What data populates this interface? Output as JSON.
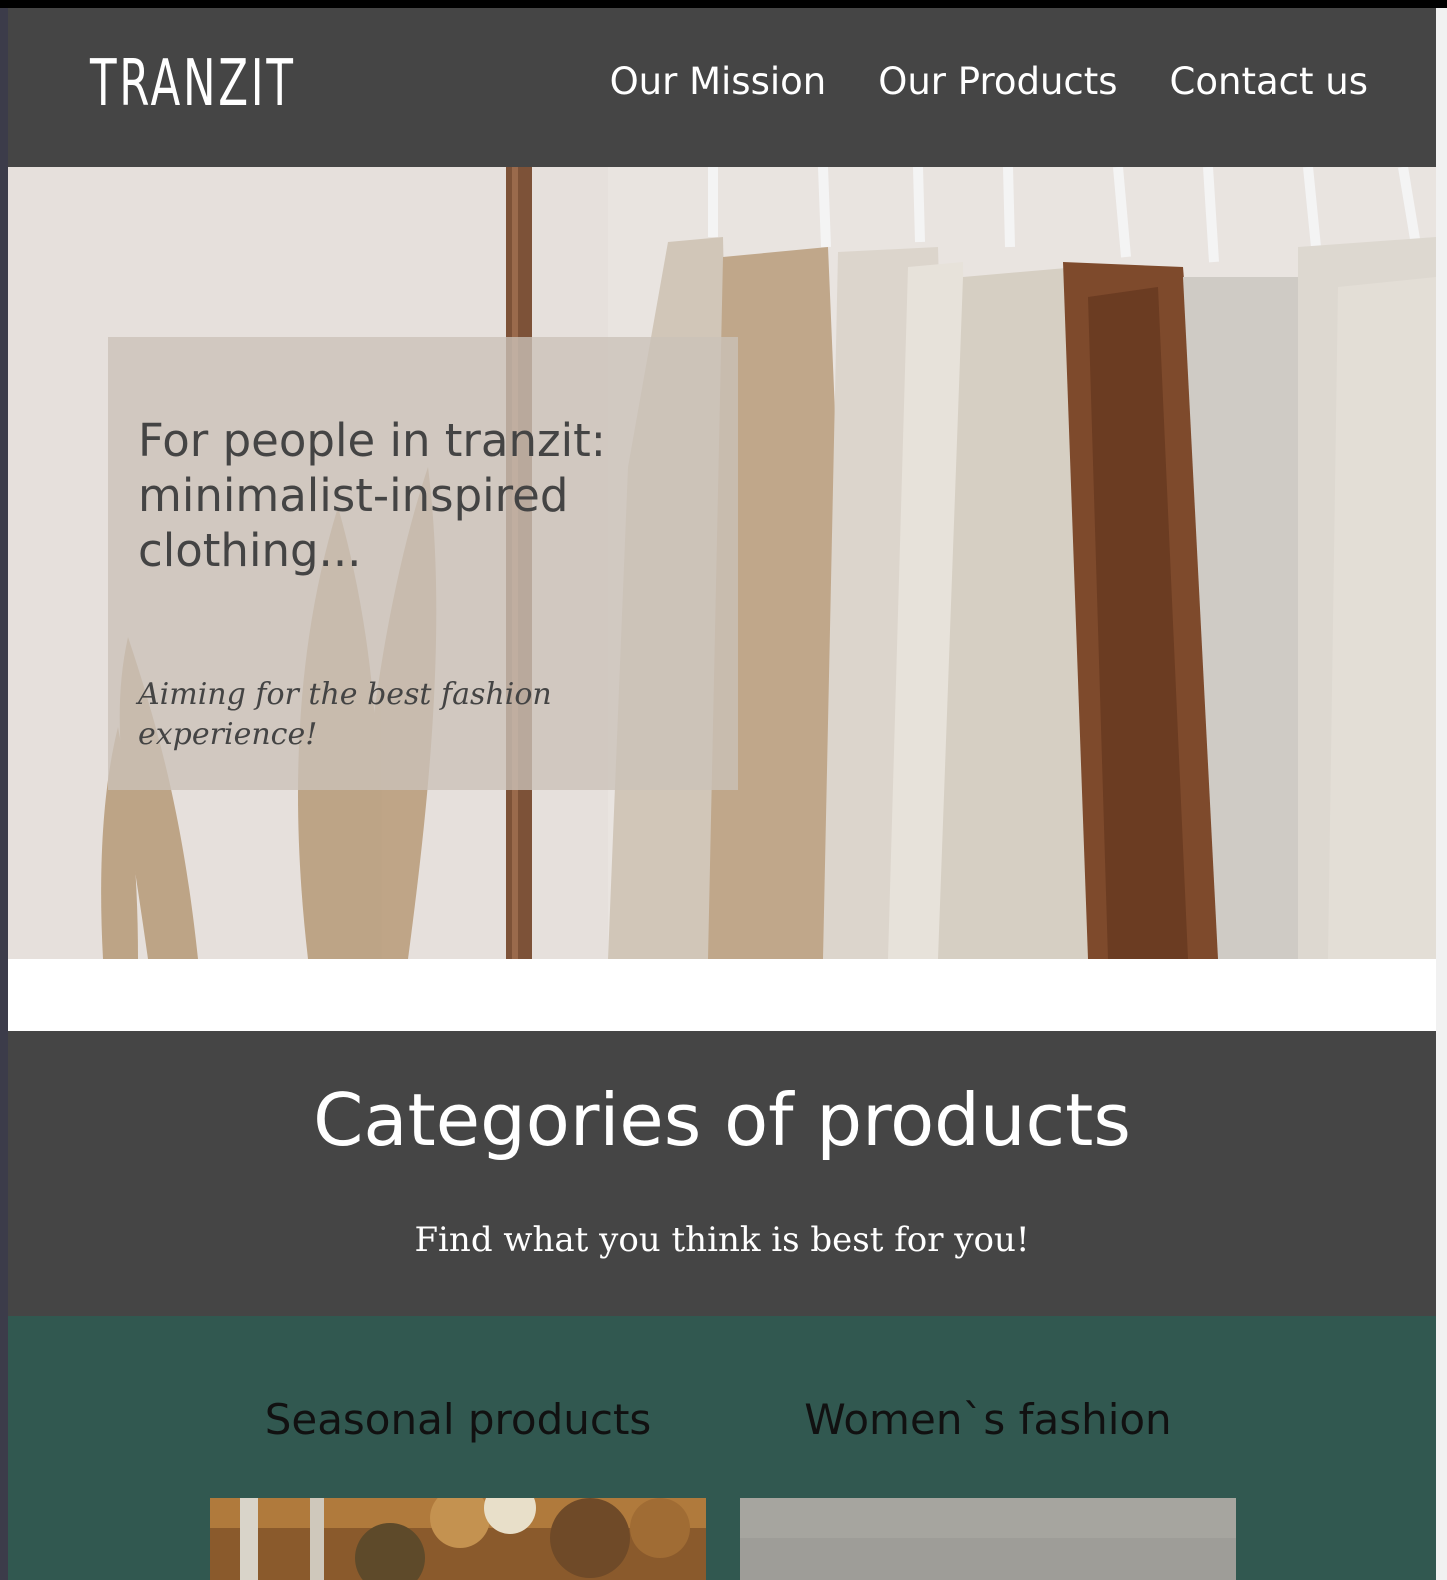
{
  "brand": {
    "logo": "TRANZIT"
  },
  "nav": {
    "items": [
      "Our Mission",
      "Our Products",
      "Contact us"
    ]
  },
  "hero": {
    "title": "For people in tranzit: minimalist-inspired clothing...",
    "subtitle": "Aiming for the best fashion experience!",
    "image": "clothing-rack-photo"
  },
  "categories": {
    "title": "Categories of products",
    "subtitle": "Find what you think is best for you!",
    "items": [
      {
        "label": "Seasonal products",
        "image": "autumn-forest-photo"
      },
      {
        "label": "Women`s fashion",
        "image": "grey-backdrop-photo"
      }
    ]
  },
  "colors": {
    "header_bg": "#454545",
    "section_bg": "#454545",
    "green_bg": "#315850",
    "hero_card_bg": "#cbc1b8"
  }
}
